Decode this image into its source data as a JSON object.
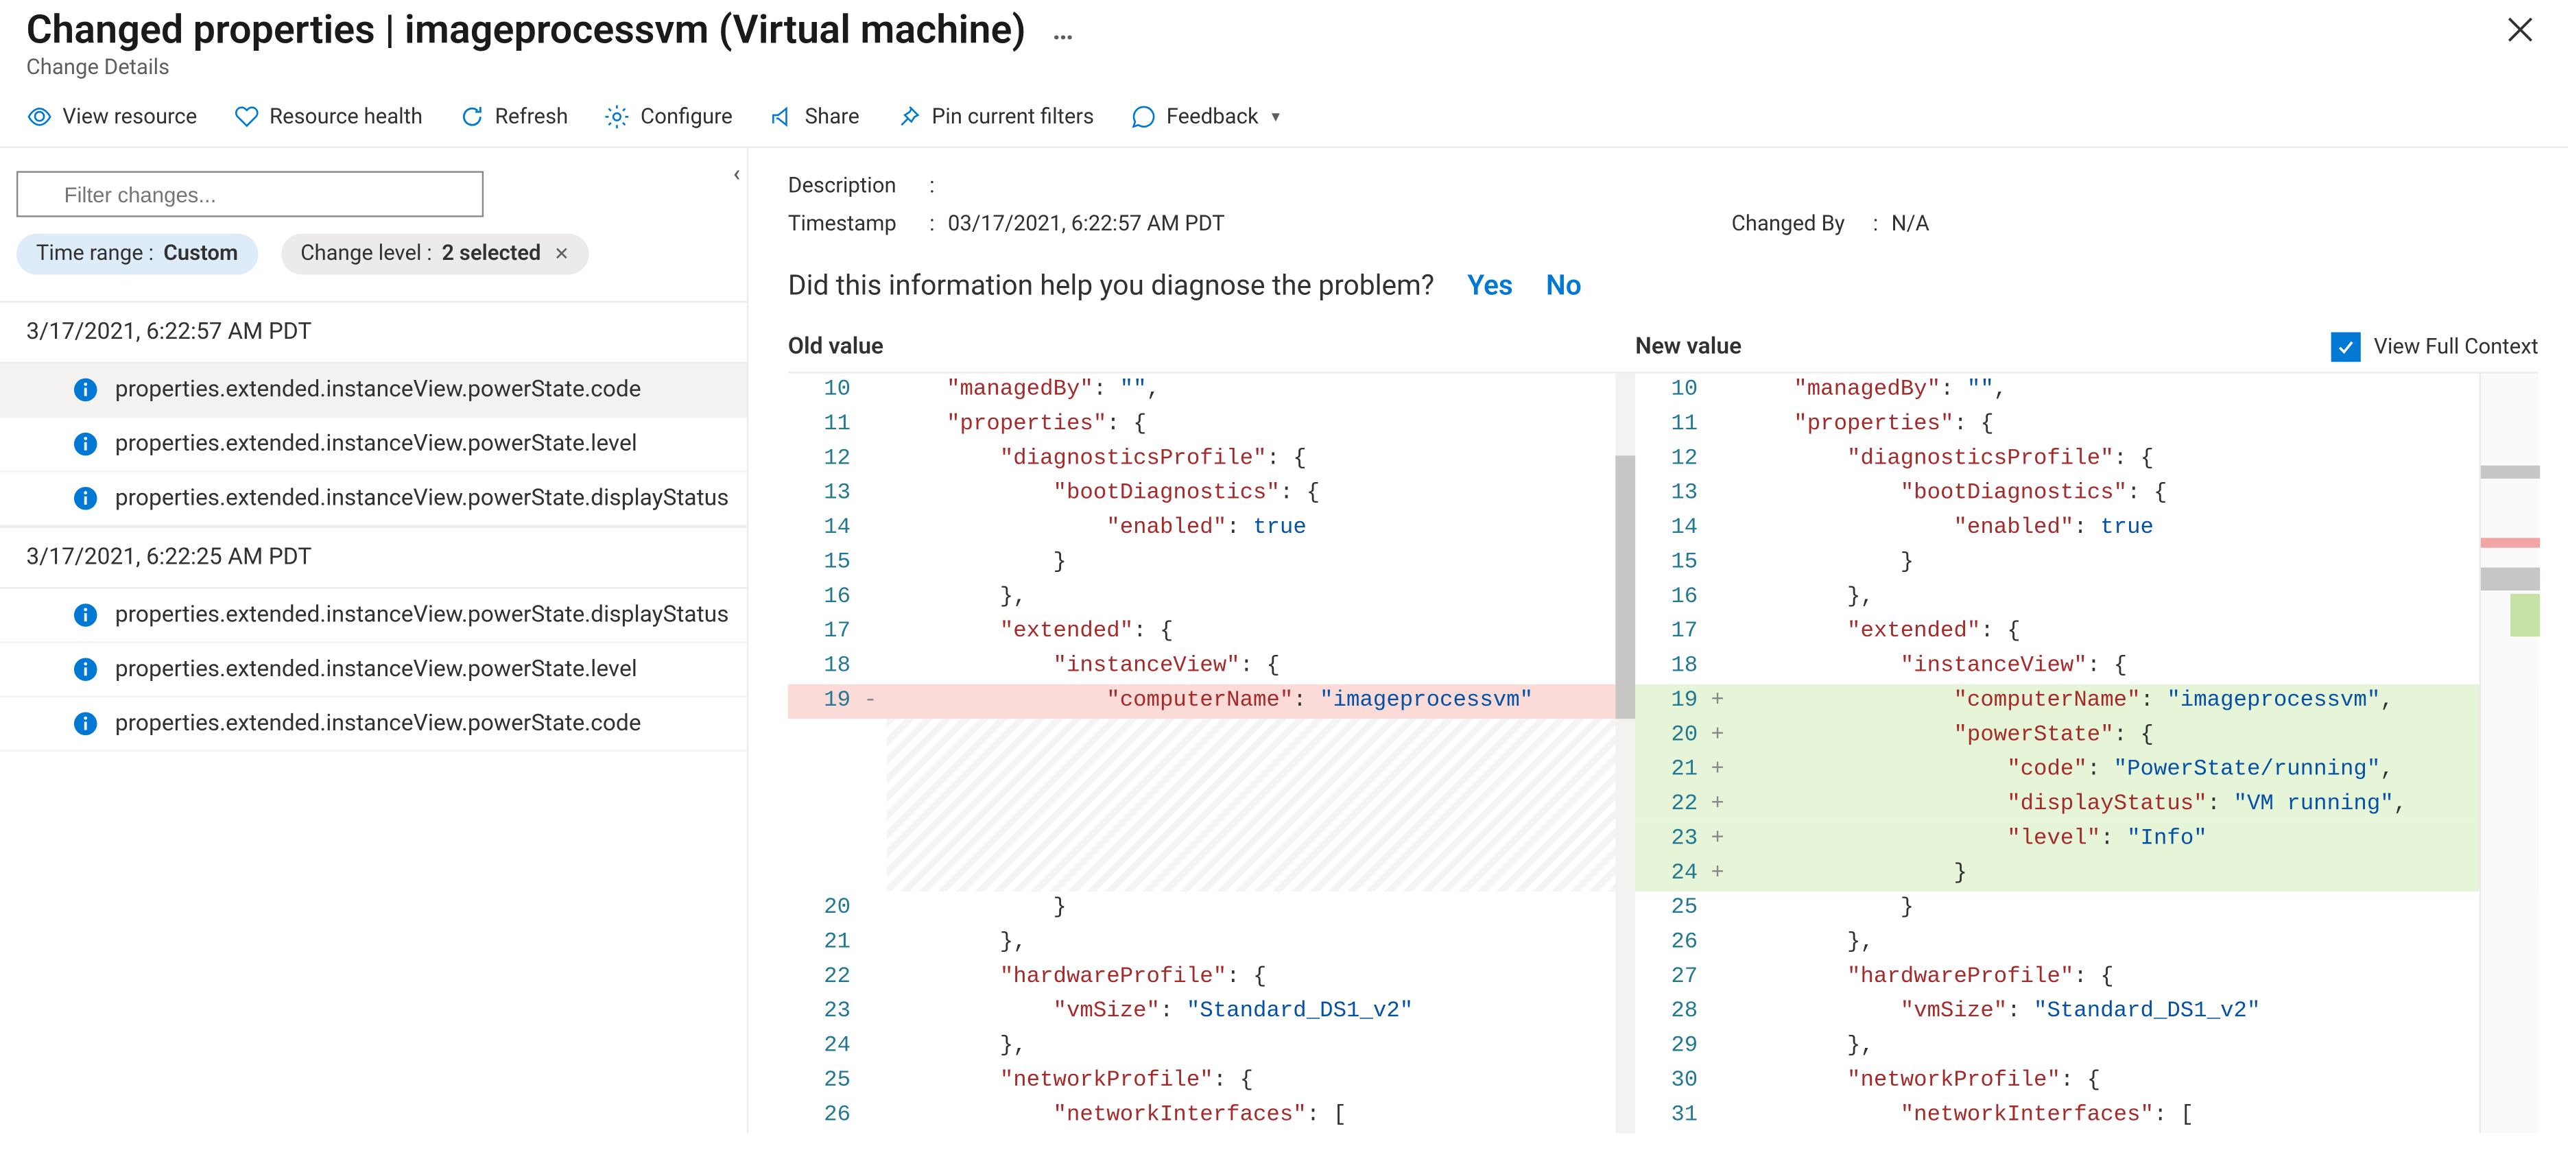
{
  "header": {
    "title": "Changed properties | imageprocessvm (Virtual machine)",
    "subtitle": "Change Details",
    "more": "…"
  },
  "toolbar": {
    "view_resource": "View resource",
    "resource_health": "Resource health",
    "refresh": "Refresh",
    "configure": "Configure",
    "share": "Share",
    "pin": "Pin current filters",
    "feedback": "Feedback"
  },
  "filter": {
    "placeholder": "Filter changes..."
  },
  "pills": {
    "time_label": "Time range : ",
    "time_value": "Custom",
    "level_label": "Change level : ",
    "level_value": "2 selected"
  },
  "groups": [
    {
      "ts": "3/17/2021, 6:22:57 AM PDT",
      "items": [
        {
          "path": "properties.extended.instanceView.powerState.code",
          "selected": true
        },
        {
          "path": "properties.extended.instanceView.powerState.level",
          "selected": false
        },
        {
          "path": "properties.extended.instanceView.powerState.displayStatus",
          "selected": false
        }
      ]
    },
    {
      "ts": "3/17/2021, 6:22:25 AM PDT",
      "items": [
        {
          "path": "properties.extended.instanceView.powerState.displayStatus",
          "selected": false
        },
        {
          "path": "properties.extended.instanceView.powerState.level",
          "selected": false
        },
        {
          "path": "properties.extended.instanceView.powerState.code",
          "selected": false
        }
      ]
    }
  ],
  "meta": {
    "description_k": "Description",
    "description_v": "",
    "timestamp_k": "Timestamp",
    "timestamp_v": "03/17/2021, 6:22:57 AM PDT",
    "changedby_k": "Changed By",
    "changedby_v": "N/A"
  },
  "diag": {
    "q": "Did this information help you diagnose the problem?",
    "yes": "Yes",
    "no": "No"
  },
  "diff": {
    "old_title": "Old value",
    "new_title": "New value",
    "vfc": "View Full Context"
  },
  "old_lines": [
    {
      "n": 10,
      "segs": [
        [
          "    ",
          ""
        ],
        [
          "\"managedBy\"",
          "k"
        ],
        [
          ": ",
          ""
        ],
        [
          "\"\"",
          "s"
        ],
        [
          ",",
          ""
        ]
      ]
    },
    {
      "n": 11,
      "segs": [
        [
          "    ",
          ""
        ],
        [
          "\"properties\"",
          "k"
        ],
        [
          ": {",
          ""
        ]
      ]
    },
    {
      "n": 12,
      "segs": [
        [
          "        ",
          ""
        ],
        [
          "\"diagnosticsProfile\"",
          "k"
        ],
        [
          ": {",
          ""
        ]
      ]
    },
    {
      "n": 13,
      "segs": [
        [
          "            ",
          ""
        ],
        [
          "\"bootDiagnostics\"",
          "k"
        ],
        [
          ": {",
          ""
        ]
      ]
    },
    {
      "n": 14,
      "segs": [
        [
          "                ",
          ""
        ],
        [
          "\"enabled\"",
          "k"
        ],
        [
          ": ",
          ""
        ],
        [
          "true",
          "n"
        ]
      ]
    },
    {
      "n": 15,
      "segs": [
        [
          "            }",
          ""
        ]
      ]
    },
    {
      "n": 16,
      "segs": [
        [
          "        },",
          ""
        ]
      ]
    },
    {
      "n": 17,
      "segs": [
        [
          "        ",
          ""
        ],
        [
          "\"extended\"",
          "k"
        ],
        [
          ": {",
          ""
        ]
      ]
    },
    {
      "n": 18,
      "segs": [
        [
          "            ",
          ""
        ],
        [
          "\"instanceView\"",
          "k"
        ],
        [
          ": {",
          ""
        ]
      ]
    },
    {
      "n": 19,
      "mark": "-",
      "cls": "del",
      "segs": [
        [
          "                ",
          ""
        ],
        [
          "\"computerName\"",
          "k"
        ],
        [
          ": ",
          ""
        ],
        [
          "\"imageprocessvm\"",
          "s"
        ]
      ]
    }
  ],
  "old_tail": [
    {
      "n": 20,
      "segs": [
        [
          "            }",
          ""
        ]
      ]
    },
    {
      "n": 21,
      "segs": [
        [
          "        },",
          ""
        ]
      ]
    },
    {
      "n": 22,
      "segs": [
        [
          "        ",
          ""
        ],
        [
          "\"hardwareProfile\"",
          "k"
        ],
        [
          ": {",
          ""
        ]
      ]
    },
    {
      "n": 23,
      "segs": [
        [
          "            ",
          ""
        ],
        [
          "\"vmSize\"",
          "k"
        ],
        [
          ": ",
          ""
        ],
        [
          "\"Standard_DS1_v2\"",
          "s"
        ]
      ]
    },
    {
      "n": 24,
      "segs": [
        [
          "        },",
          ""
        ]
      ]
    },
    {
      "n": 25,
      "segs": [
        [
          "        ",
          ""
        ],
        [
          "\"networkProfile\"",
          "k"
        ],
        [
          ": {",
          ""
        ]
      ]
    },
    {
      "n": 26,
      "segs": [
        [
          "            ",
          ""
        ],
        [
          "\"networkInterfaces\"",
          "k"
        ],
        [
          ": [",
          ""
        ]
      ]
    }
  ],
  "new_lines": [
    {
      "n": 10,
      "segs": [
        [
          "    ",
          ""
        ],
        [
          "\"managedBy\"",
          "k"
        ],
        [
          ": ",
          ""
        ],
        [
          "\"\"",
          "s"
        ],
        [
          ",",
          ""
        ]
      ]
    },
    {
      "n": 11,
      "segs": [
        [
          "    ",
          ""
        ],
        [
          "\"properties\"",
          "k"
        ],
        [
          ": {",
          ""
        ]
      ]
    },
    {
      "n": 12,
      "segs": [
        [
          "        ",
          ""
        ],
        [
          "\"diagnosticsProfile\"",
          "k"
        ],
        [
          ": {",
          ""
        ]
      ]
    },
    {
      "n": 13,
      "segs": [
        [
          "            ",
          ""
        ],
        [
          "\"bootDiagnostics\"",
          "k"
        ],
        [
          ": {",
          ""
        ]
      ]
    },
    {
      "n": 14,
      "segs": [
        [
          "                ",
          ""
        ],
        [
          "\"enabled\"",
          "k"
        ],
        [
          ": ",
          ""
        ],
        [
          "true",
          "n"
        ]
      ]
    },
    {
      "n": 15,
      "segs": [
        [
          "            }",
          ""
        ]
      ]
    },
    {
      "n": 16,
      "segs": [
        [
          "        },",
          ""
        ]
      ]
    },
    {
      "n": 17,
      "segs": [
        [
          "        ",
          ""
        ],
        [
          "\"extended\"",
          "k"
        ],
        [
          ": {",
          ""
        ]
      ]
    },
    {
      "n": 18,
      "segs": [
        [
          "            ",
          ""
        ],
        [
          "\"instanceView\"",
          "k"
        ],
        [
          ": {",
          ""
        ]
      ]
    },
    {
      "n": 19,
      "mark": "+",
      "cls": "add",
      "segs": [
        [
          "                ",
          ""
        ],
        [
          "\"computerName\"",
          "k"
        ],
        [
          ": ",
          ""
        ],
        [
          "\"imageprocessvm\"",
          "s"
        ],
        [
          ",",
          ""
        ]
      ]
    },
    {
      "n": 20,
      "mark": "+",
      "cls": "add",
      "segs": [
        [
          "                ",
          ""
        ],
        [
          "\"powerState\"",
          "k"
        ],
        [
          ": {",
          ""
        ]
      ]
    },
    {
      "n": 21,
      "mark": "+",
      "cls": "add",
      "segs": [
        [
          "                    ",
          ""
        ],
        [
          "\"code\"",
          "k"
        ],
        [
          ": ",
          ""
        ],
        [
          "\"PowerState/running\"",
          "s"
        ],
        [
          ",",
          ""
        ]
      ]
    },
    {
      "n": 22,
      "mark": "+",
      "cls": "add",
      "segs": [
        [
          "                    ",
          ""
        ],
        [
          "\"displayStatus\"",
          "k"
        ],
        [
          ": ",
          ""
        ],
        [
          "\"VM running\"",
          "s"
        ],
        [
          ",",
          ""
        ]
      ]
    },
    {
      "n": 23,
      "mark": "+",
      "cls": "add",
      "segs": [
        [
          "                    ",
          ""
        ],
        [
          "\"level\"",
          "k"
        ],
        [
          ": ",
          ""
        ],
        [
          "\"Info\"",
          "s"
        ]
      ]
    },
    {
      "n": 24,
      "mark": "+",
      "cls": "add",
      "segs": [
        [
          "                }",
          ""
        ]
      ]
    },
    {
      "n": 25,
      "segs": [
        [
          "            }",
          ""
        ]
      ]
    },
    {
      "n": 26,
      "segs": [
        [
          "        },",
          ""
        ]
      ]
    },
    {
      "n": 27,
      "segs": [
        [
          "        ",
          ""
        ],
        [
          "\"hardwareProfile\"",
          "k"
        ],
        [
          ": {",
          ""
        ]
      ]
    },
    {
      "n": 28,
      "segs": [
        [
          "            ",
          ""
        ],
        [
          "\"vmSize\"",
          "k"
        ],
        [
          ": ",
          ""
        ],
        [
          "\"Standard_DS1_v2\"",
          "s"
        ]
      ]
    },
    {
      "n": 29,
      "segs": [
        [
          "        },",
          ""
        ]
      ]
    },
    {
      "n": 30,
      "segs": [
        [
          "        ",
          ""
        ],
        [
          "\"networkProfile\"",
          "k"
        ],
        [
          ": {",
          ""
        ]
      ]
    },
    {
      "n": 31,
      "segs": [
        [
          "            ",
          ""
        ],
        [
          "\"networkInterfaces\"",
          "k"
        ],
        [
          ": [",
          ""
        ]
      ]
    }
  ]
}
